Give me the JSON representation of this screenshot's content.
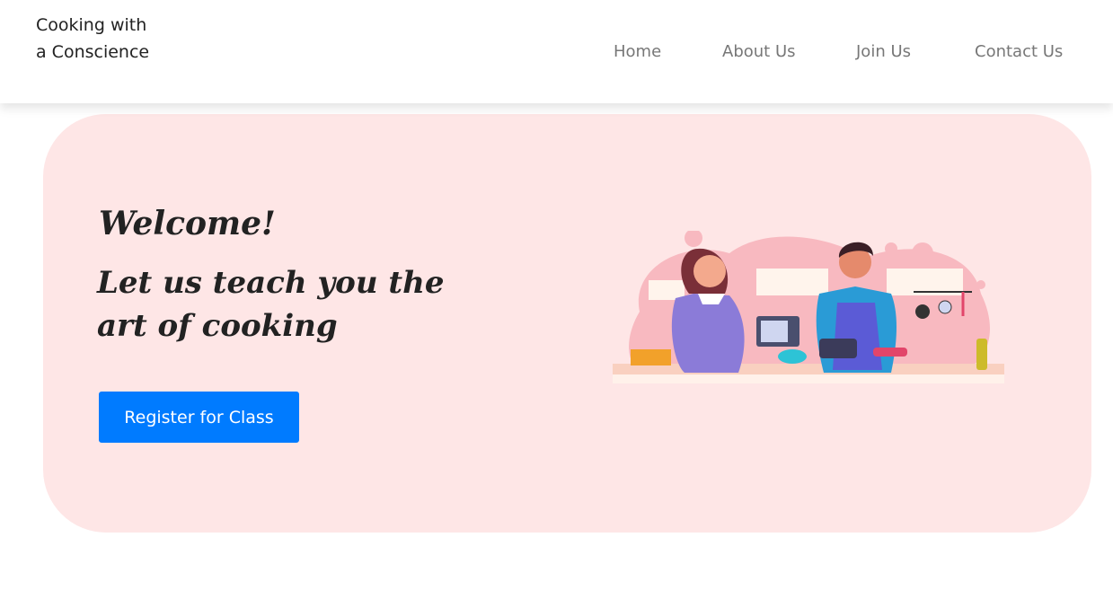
{
  "brand": {
    "name": "Cooking with a Conscience"
  },
  "nav": {
    "items": [
      {
        "label": "Home"
      },
      {
        "label": "About Us"
      },
      {
        "label": "Join Us"
      },
      {
        "label": "Contact Us"
      }
    ]
  },
  "hero": {
    "welcome": "Welcome!",
    "tagline": "Let us teach you the art of cooking",
    "register_label": "Register for Class"
  },
  "colors": {
    "hero_background": "#fee6e6",
    "button_primary": "#007bff",
    "nav_text": "#777777"
  },
  "icons": {
    "hero_illustration": "couple-cooking-in-kitchen-illustration"
  }
}
